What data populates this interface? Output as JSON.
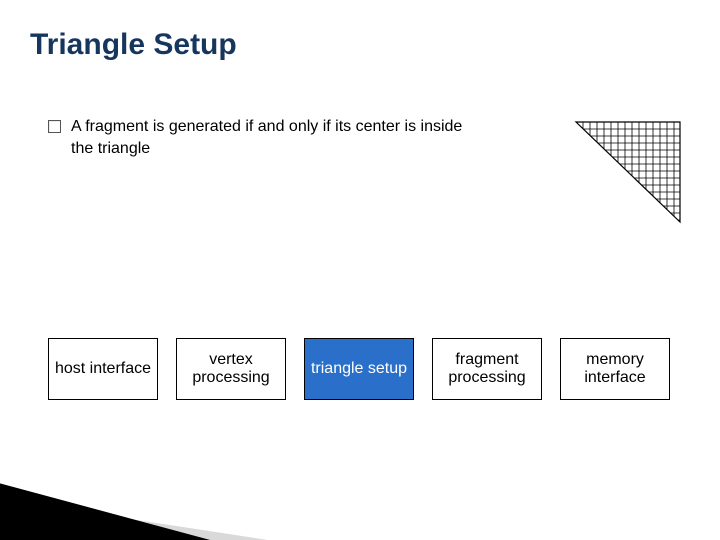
{
  "title": "Triangle Setup",
  "bullet": {
    "text": "A fragment is generated if and only if its center is inside the triangle"
  },
  "pipeline": [
    {
      "label": "host interface",
      "highlight": false
    },
    {
      "label": "vertex processing",
      "highlight": false
    },
    {
      "label": "triangle setup",
      "highlight": true
    },
    {
      "label": "fragment processing",
      "highlight": false
    },
    {
      "label": "memory interface",
      "highlight": false
    }
  ],
  "colors": {
    "title": "#17365d",
    "highlight_bg": "#2a6fc9"
  }
}
